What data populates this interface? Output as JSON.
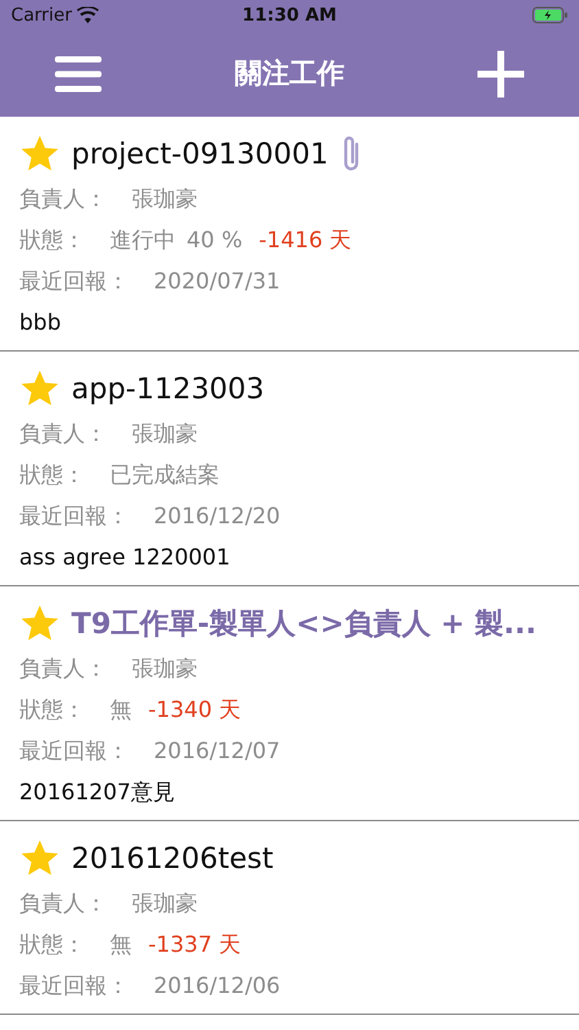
{
  "status_bar": {
    "carrier": "Carrier",
    "time": "11:30 AM"
  },
  "nav": {
    "title": "關注工作"
  },
  "tasks": [
    {
      "title": "project-09130001",
      "color": "#111111",
      "starred": true,
      "attachment": true,
      "owner_label": "負責人：",
      "owner": "張珈豪",
      "status_label": "狀態：",
      "status": "進行中",
      "progress": "40 %",
      "overdue": "-1416 天",
      "report_label": "最近回報：",
      "report_date": "2020/07/31",
      "note": "bbb"
    },
    {
      "title": "app-1123003",
      "color": "#111111",
      "starred": true,
      "attachment": false,
      "owner_label": "負責人：",
      "owner": "張珈豪",
      "status_label": "狀態：",
      "status": "已完成結案",
      "report_label": "最近回報：",
      "report_date": "2016/12/20",
      "note": "ass agree 1220001"
    },
    {
      "title": "T9工作單-製單人<>負責人 + 製...",
      "color": "#7b6aa8",
      "starred": true,
      "attachment": false,
      "owner_label": "負責人：",
      "owner": "張珈豪",
      "status_label": "狀態：",
      "status": "無",
      "overdue": "-1340 天",
      "report_label": "最近回報：",
      "report_date": "2016/12/07",
      "note": "20161207意見"
    },
    {
      "title": "20161206test",
      "color": "#111111",
      "starred": true,
      "attachment": false,
      "owner_label": "負責人：",
      "owner": "張珈豪",
      "status_label": "狀態：",
      "status": "無",
      "overdue": "-1337 天",
      "report_label": "最近回報：",
      "report_date": "2016/12/06"
    }
  ]
}
